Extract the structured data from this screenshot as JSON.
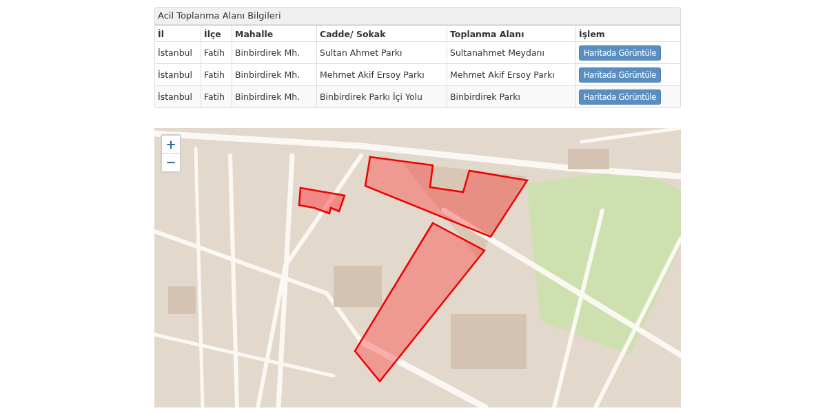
{
  "panel": {
    "title": "Acil Toplanma Alanı Bilgileri"
  },
  "table": {
    "columns": [
      "İl",
      "İlçe",
      "Mahalle",
      "Cadde/ Sokak",
      "Toplanma Alanı",
      "İşlem"
    ],
    "rows": [
      {
        "cells": [
          "İstanbul",
          "Fatih",
          "Binbirdirek Mh.",
          "Sultan Ahmet Parkı",
          "Sultanahmet Meydanı"
        ],
        "action": "Haritada Görüntüle"
      },
      {
        "cells": [
          "İstanbul",
          "Fatih",
          "Binbirdirek Mh.",
          "Mehmet Akif Ersoy Parkı",
          "Mehmet Akif Ersoy Parkı"
        ],
        "action": "Haritada Görüntüle"
      },
      {
        "cells": [
          "İstanbul",
          "Fatih",
          "Binbirdirek Mh.",
          "Binbirdirek Parkı İçi Yolu",
          "Binbirdirek Parkı"
        ],
        "action": "Haritada Görüntüle"
      }
    ]
  },
  "map": {
    "zoom_in": "+",
    "zoom_out": "−"
  }
}
